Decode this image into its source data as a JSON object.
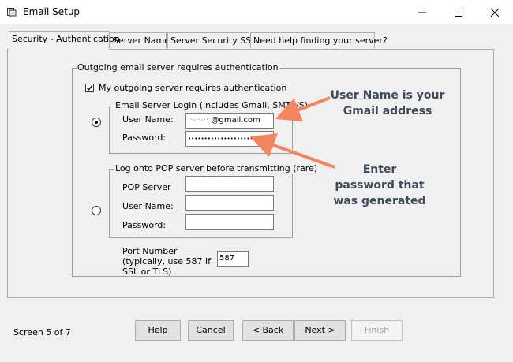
{
  "window": {
    "title": "Email Setup"
  },
  "tabs": [
    {
      "label": "Security - Authentication"
    },
    {
      "label": "Server Name"
    },
    {
      "label": "Server Security SSL"
    },
    {
      "label": "Need help finding your server?"
    }
  ],
  "outgoing_group": {
    "legend": "Outgoing email server requires authentication",
    "checkbox_label": "My outgoing server requires authentication",
    "checked": true
  },
  "login_group": {
    "legend": "Email Server Login (includes Gmail, SMTP/S)",
    "username_label": "User Name:",
    "username_value": "@gmail.com",
    "password_label": "Password:",
    "password_value": "••••••••••••••••••••••",
    "selected": true
  },
  "pop_group": {
    "legend": "Log onto POP server before transmitting (rare)",
    "pop_server_label": "POP Server",
    "username_label": "User Name:",
    "password_label": "Password:",
    "selected": false
  },
  "port": {
    "label": "Port Number (typically, use 587 if SSL or TLS)",
    "value": "587"
  },
  "annotations": {
    "username_note": "User Name is your Gmail address",
    "password_note": "Enter password that was generated"
  },
  "footer": {
    "screen_indicator": "Screen 5 of 7",
    "buttons": {
      "help": "Help",
      "cancel": "Cancel",
      "back": "< Back",
      "next": "Next >",
      "finish": "Finish"
    }
  },
  "colors": {
    "annotation_arrow": "#f4845f",
    "annotation_text": "#3f4a5a"
  }
}
